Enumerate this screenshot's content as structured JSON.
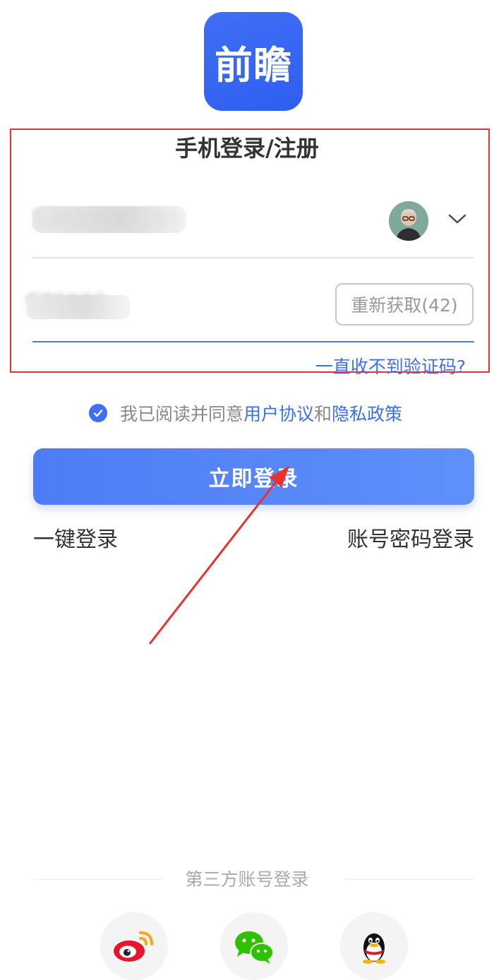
{
  "app": {
    "logo_text": "前瞻"
  },
  "form": {
    "title": "手机登录/注册",
    "phone_value": "13923587291",
    "code_value": "581111",
    "resend_label": "重新获取(42)",
    "no_code_label": "一直收不到验证码?"
  },
  "agreement": {
    "prefix": "我已阅读并同意",
    "user_agreement": "用户协议",
    "and": "和",
    "privacy_policy": "隐私政策",
    "checked": true
  },
  "actions": {
    "login_label": "立即登录",
    "one_click_label": "一键登录",
    "password_login_label": "账号密码登录"
  },
  "third_party": {
    "label": "第三方账号登录",
    "providers": [
      "weibo-icon",
      "wechat-icon",
      "qq-icon"
    ]
  },
  "colors": {
    "accent": "#3f6ff6",
    "annotation": "#e8322f"
  }
}
